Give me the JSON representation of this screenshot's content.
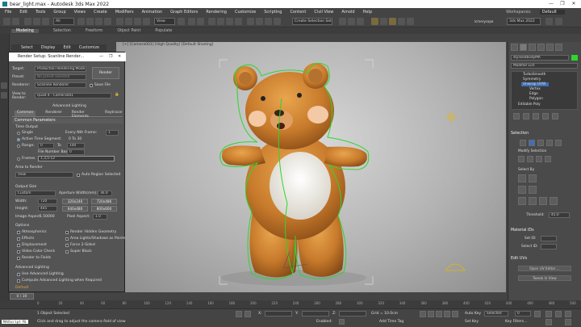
{
  "window": {
    "title": "bear_light.max - Autodesk 3ds Max 2022",
    "controls": [
      "—",
      "❐",
      "✕"
    ]
  },
  "menus": [
    "File",
    "Edit",
    "Tools",
    "Group",
    "Views",
    "Create",
    "Modifiers",
    "Animation",
    "Graph Editors",
    "Rendering",
    "Customize",
    "Scripting",
    "Content",
    "Civil View",
    "Arnold",
    "Help"
  ],
  "workspace": {
    "label": "Workspaces:",
    "value": "Default"
  },
  "toolbar": {
    "view_select": "View",
    "selection_set": "Create Selection Set",
    "user_label": "lcmerycope",
    "version_label": "3ds Max 2022"
  },
  "ribbon": {
    "tabs": [
      "Modeling",
      "Selection",
      "Freeform",
      "Object Paint",
      "Populate"
    ],
    "active": 0
  },
  "scene_explorer": {
    "tabs": [
      "Select",
      "Display",
      "Edit",
      "Customize"
    ]
  },
  "viewport": {
    "label": "[+] [Camera001] [High Quality] [Default Shading]"
  },
  "render_dialog": {
    "title": "Render Setup: Scanline Render...",
    "target_label": "Target:",
    "target_value": "Production Rendering Mode",
    "preset_label": "Preset:",
    "preset_value": "No preset selected",
    "renderer_label": "Renderer:",
    "renderer_value": "Scanline Renderer",
    "save_file": "Save File",
    "view_label": "View to Render:",
    "view_value": "Quad 4 - Camera001",
    "render_button": "Render",
    "advanced_lighting_tab": "Advanced Lighting",
    "tabs": [
      "Common",
      "Renderer",
      "Render Elements",
      "Raytracer"
    ],
    "common_params": "Common Parameters",
    "time_output": "Time Output",
    "single": "Single",
    "every_nth_label": "Every Nth Frame:",
    "every_nth": "1",
    "active_segment": "Active Time Segment:",
    "active_range": "0 To 30",
    "range_label": "Range:",
    "range_from": "0",
    "range_to_label": "To",
    "range_to": "100",
    "file_number_base_label": "File Number Base:",
    "file_number_base": "0",
    "frames_label": "Frames",
    "frames_value": "1,3,5-12",
    "area_label": "Area to Render",
    "area_value": "View",
    "auto_region": "Auto Region Selected",
    "output_size": "Output Size",
    "size_preset": "Custom",
    "aperture_label": "Aperture Width(mm):",
    "aperture_value": "36.0",
    "width_label": "Width:",
    "width_value": "720",
    "height_label": "Height:",
    "height_value": "405",
    "res": [
      "320x240",
      "720x486",
      "640x480",
      "800x600"
    ],
    "image_aspect_label": "Image Aspect:",
    "image_aspect": "1.50000",
    "pixel_aspect_label": "Pixel Aspect:",
    "pixel_aspect": "1.0",
    "options": "Options",
    "opt_left": [
      "Atmospherics",
      "Effects",
      "Displacement",
      "Video Color Check",
      "Render to Fields"
    ],
    "opt_left_state": [
      true,
      true,
      true,
      false,
      false
    ],
    "opt_right": [
      "Render Hidden Geometry",
      "Area Lights/Shadows as Points",
      "Force 2-Sided",
      "Super Black"
    ],
    "opt_right_state": [
      false,
      false,
      true,
      false
    ],
    "advanced_lighting": "Advanced Lighting",
    "use_adv": "Use Advanced Lighting",
    "compute_adv": "Compute Advanced Lighting when Required",
    "default_preset": "Default"
  },
  "command_panel": {
    "object_name": "stylisedbodyMA",
    "modifier_list": "Modifier List",
    "stack": [
      {
        "name": "TurboSmooth",
        "indent": 0,
        "selected": false
      },
      {
        "name": "Symmetry",
        "indent": 0,
        "selected": false
      },
      {
        "name": "Unwrap UVW",
        "indent": 0,
        "selected": true
      },
      {
        "name": "Vertex",
        "indent": 1,
        "selected": false
      },
      {
        "name": "Edge",
        "indent": 1,
        "selected": false
      },
      {
        "name": "Polygon",
        "indent": 1,
        "selected": false
      },
      {
        "name": "Editable Poly",
        "indent": 0,
        "selected": false
      }
    ],
    "selection": "Selection",
    "modify_selection": "Modify Selection",
    "select_by": "Select By",
    "threshold_label": "Threshold:",
    "threshold_value": "45.0",
    "material_ids": "Material IDs",
    "set_id": "Set ID:",
    "select_id": "Select ID:",
    "edit_uvs": "Edit UVs",
    "open_uv_editor": "Open UV Editor ...",
    "tweak_in_view": "Tweak In View"
  },
  "timeline": {
    "frame": "0 / 30",
    "ticks": [
      "0",
      "10",
      "20",
      "30",
      "40",
      "50",
      "60",
      "70",
      "80",
      "90",
      "100",
      "110",
      "120",
      "130",
      "140",
      "150",
      "160",
      "170",
      "180",
      "190",
      "200",
      "210",
      "220",
      "230",
      "240",
      "250",
      "260",
      "270",
      "280",
      "290",
      "300",
      "310",
      "320",
      "330",
      "340",
      "350",
      "360",
      "370",
      "380",
      "390",
      "400",
      "410",
      "420",
      "430",
      "440",
      "450",
      "460",
      "470",
      "480",
      "490",
      "500"
    ]
  },
  "status": {
    "maxscript": "MAXScript Mi",
    "objects": "1 Object Selected",
    "hint": "Click and drag to adjust the camera field of view",
    "x_label": "X:",
    "y_label": "Y:",
    "z_label": "Z:",
    "grid": "Grid = 10.0cm",
    "enabled": "Enabled:",
    "add_time_tag": "Add Time Tag",
    "auto_key": "Auto Key",
    "selected": "Selected",
    "set_key": "Set Key",
    "key_filters": "Key Filters...",
    "frame_value": "0"
  }
}
